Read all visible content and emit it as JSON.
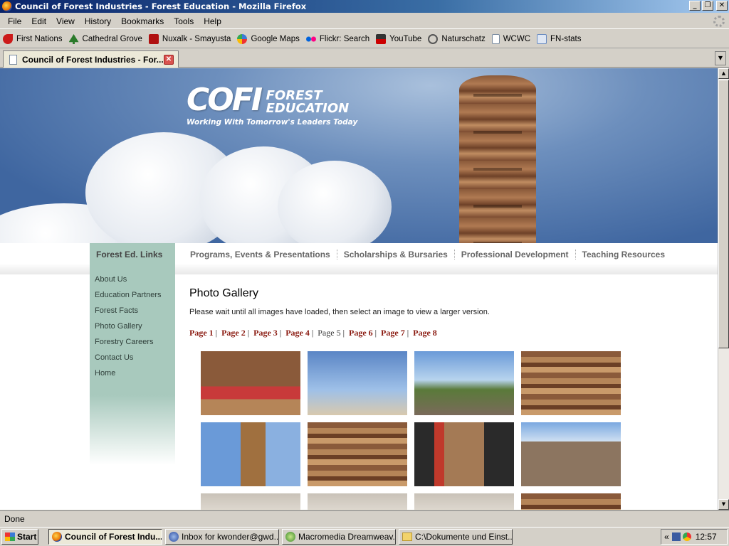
{
  "window": {
    "title": "Council of Forest Industries - Forest Education - Mozilla Firefox",
    "buttons": [
      "_",
      "❐",
      "✕"
    ]
  },
  "menu": [
    "File",
    "Edit",
    "View",
    "History",
    "Bookmarks",
    "Tools",
    "Help"
  ],
  "bookmarks": [
    {
      "label": "First Nations",
      "icon": "bird-icon",
      "color": "#cc1a1a"
    },
    {
      "label": "Cathedral Grove",
      "icon": "tree-icon",
      "color": "#2a7a2a"
    },
    {
      "label": "Nuxalk - Smayusta",
      "icon": "n-logo-icon",
      "color": "#b01010"
    },
    {
      "label": "Google Maps",
      "icon": "google-maps-icon",
      "color": "#3b7bd8"
    },
    {
      "label": "Flickr: Search",
      "icon": "flickr-icon",
      "color": "#ff0084"
    },
    {
      "label": "YouTube",
      "icon": "youtube-icon",
      "color": "#cc0000"
    },
    {
      "label": "Naturschatz",
      "icon": "naturschatz-icon",
      "color": "#555555"
    },
    {
      "label": "WCWC",
      "icon": "page-icon",
      "color": "#ffffff"
    },
    {
      "label": "FN-stats",
      "icon": "stats-icon",
      "color": "#6a8bc0"
    }
  ],
  "tab": {
    "label": "Council of Forest Industries - For...",
    "close": "✕"
  },
  "site": {
    "logo_mark": "COFI",
    "logo_line1": "FOREST",
    "logo_line2": "EDUCATION",
    "tagline": "Working With Tomorrow's Leaders Today",
    "side_title": "Forest Ed. Links",
    "top_nav": [
      "Programs, Events & Presentations",
      "Scholarships & Bursaries",
      "Professional Development",
      "Teaching Resources"
    ],
    "side_links": [
      "About Us",
      "Education Partners",
      "Forest Facts",
      "Photo Gallery",
      "Forestry Careers",
      "Contact Us",
      "Home"
    ],
    "heading": "Photo Gallery",
    "intro": "Please wait until all images have loaded, then select an image to view a larger version.",
    "pages": [
      "Page 1",
      "Page 2",
      "Page 3",
      "Page 4",
      "Page 5",
      "Page 6",
      "Page 7",
      "Page 8"
    ],
    "current_page": "Page 5"
  },
  "status": {
    "text": "Done"
  },
  "taskbar": {
    "start": "Start",
    "items": [
      {
        "label": "Council of Forest Indu...",
        "icon": "firefox-icon"
      },
      {
        "label": "Inbox for kwonder@gwd...",
        "icon": "thunderbird-icon"
      },
      {
        "label": "Macromedia Dreamweav...",
        "icon": "dreamweaver-icon"
      },
      {
        "label": "C:\\Dokumente und Einst...",
        "icon": "folder-icon"
      }
    ],
    "tray_chevron": "«",
    "clock": "12:57"
  }
}
